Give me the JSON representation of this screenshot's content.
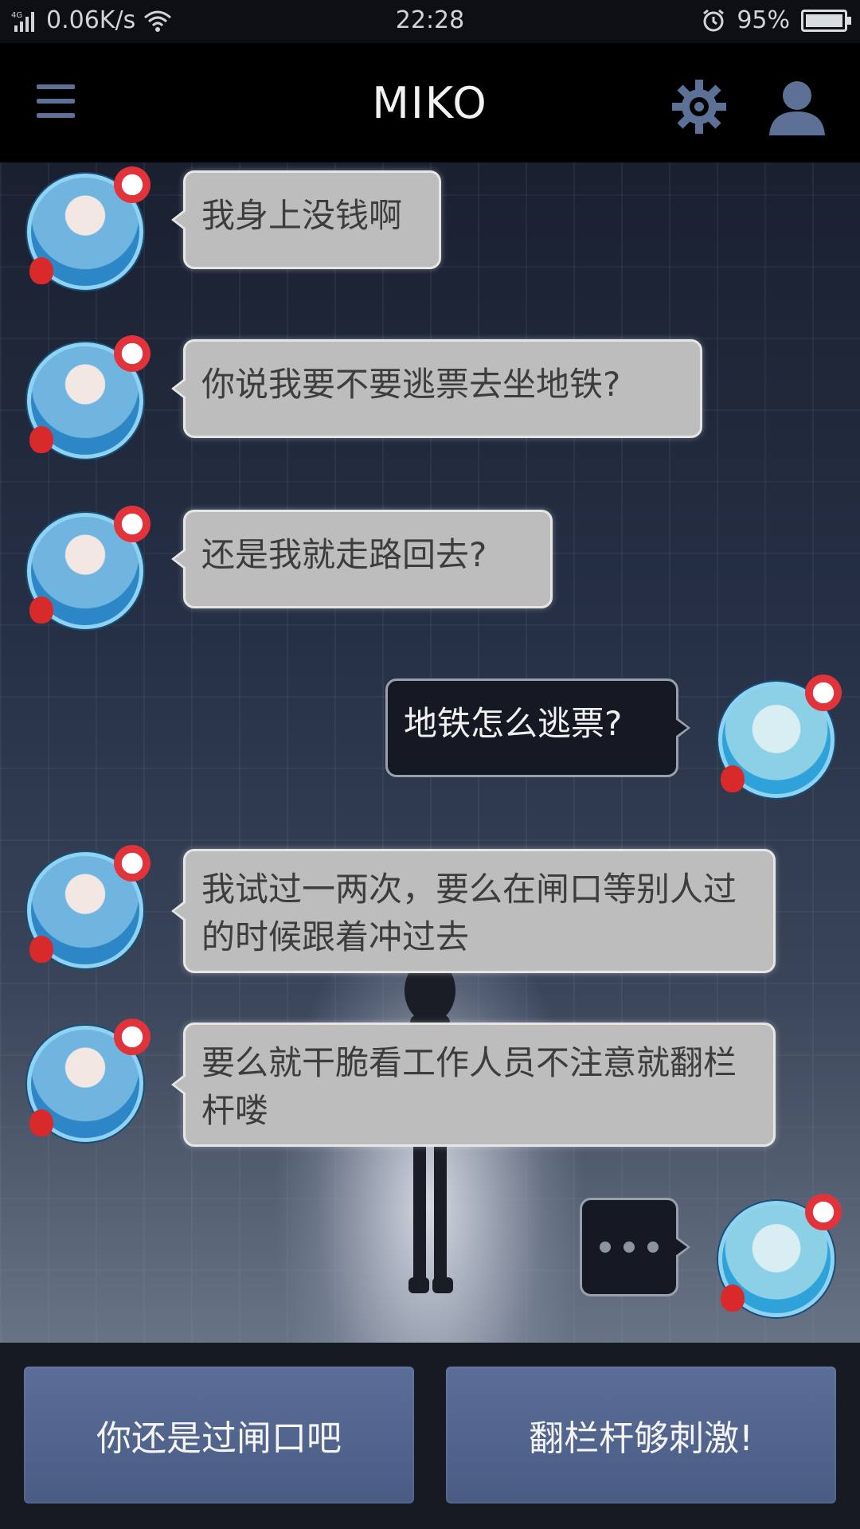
{
  "status_bar": {
    "network": "4G",
    "speed": "0.06K/s",
    "time": "22:28",
    "battery_percent": "95%",
    "battery_level": 0.95
  },
  "app_bar": {
    "title": "MIKO",
    "icons": [
      "menu-icon",
      "gear-icon",
      "user-icon"
    ]
  },
  "chat": {
    "messages": [
      {
        "sender": "them",
        "text": "我身上没钱啊"
      },
      {
        "sender": "them",
        "text": "你说我要不要逃票去坐地铁?"
      },
      {
        "sender": "them",
        "text": "还是我就走路回去?"
      },
      {
        "sender": "me",
        "text": "地铁怎么逃票?"
      },
      {
        "sender": "them",
        "text": "我试过一两次，要么在闸口等别人过的时候跟着冲过去"
      },
      {
        "sender": "them",
        "text": "要么就干脆看工作人员不注意就翻栏杆喽"
      },
      {
        "sender": "me",
        "text": "",
        "typing": true
      }
    ]
  },
  "replies": {
    "option1": "你还是过闸口吧",
    "option2": "翻栏杆够刺激!"
  },
  "colors": {
    "accent": "#5d7196",
    "reply_button": "#4f6189",
    "bubble_them": "#bdbdbd",
    "bubble_me": "#151924"
  }
}
